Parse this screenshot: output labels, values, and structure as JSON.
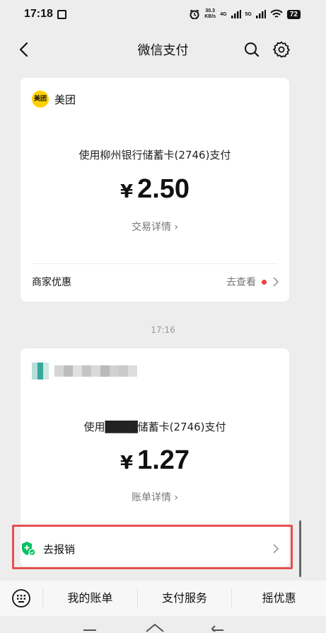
{
  "status": {
    "time": "17:18",
    "time_icon": "ⓘ",
    "speed_top": "30.3",
    "speed_bottom": "KB/s",
    "net1": "4G",
    "net2": "5G",
    "battery": "72"
  },
  "nav": {
    "title": "微信支付",
    "icons": [
      "back-icon",
      "search-icon",
      "gear-icon"
    ]
  },
  "transactions": [
    {
      "merchant_logo": "美团",
      "merchant_name": "美团",
      "pay_method": "使用柳州银行储蓄卡(2746)支付",
      "currency": "¥",
      "amount": "2.50",
      "detail_link": "交易详情 ›",
      "offer_label": "商家优惠",
      "offer_link": "去查看"
    },
    {
      "pay_method": "使用████储蓄卡(2746)支付",
      "currency": "¥",
      "amount": "1.27",
      "detail_link": "账单详情 ›",
      "report_label": "去报销"
    }
  ],
  "time_separator": "17:16",
  "bottom_menu": {
    "items": [
      "我的账单",
      "支付服务",
      "摇优惠"
    ]
  },
  "colors": {
    "accent_green": "#07c160",
    "highlight_red": "#e5504f",
    "meituan_yellow": "#ffd100"
  }
}
